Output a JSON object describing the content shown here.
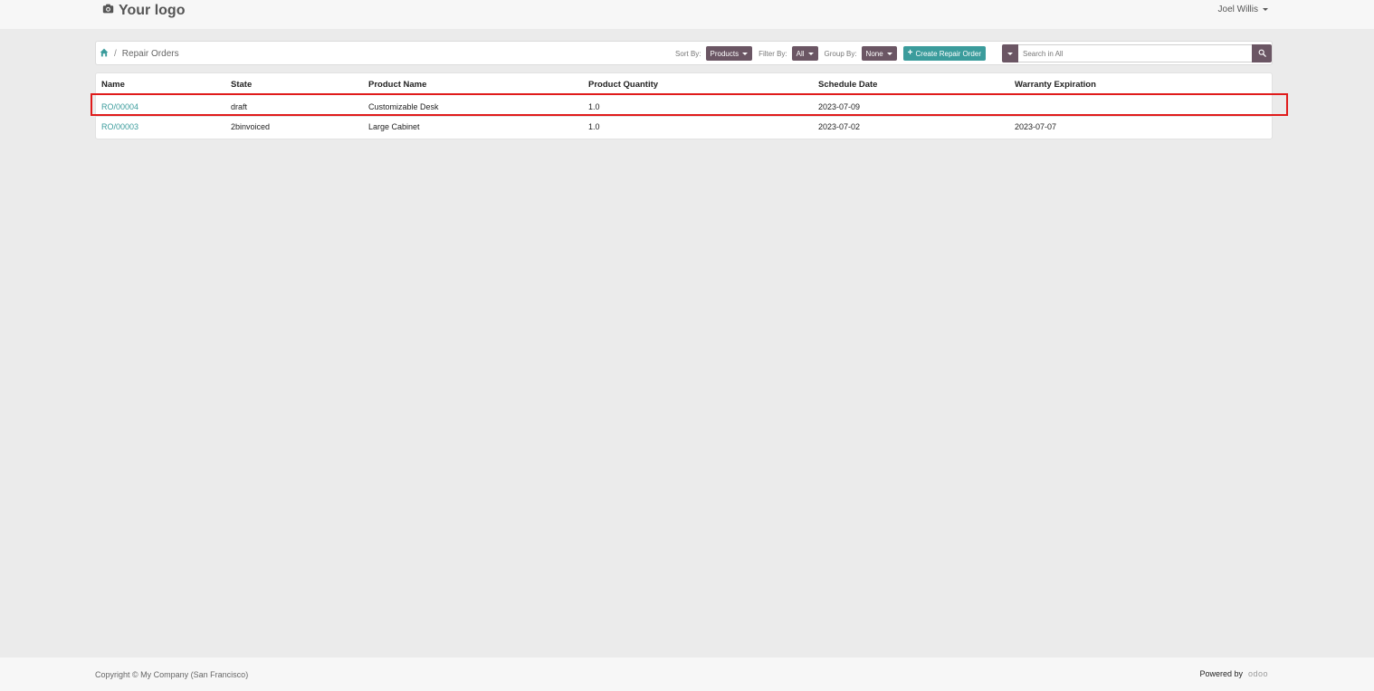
{
  "brand": {
    "logo_text": "Your logo",
    "logo_icon": "camera-icon"
  },
  "user": {
    "name": "Joel Willis"
  },
  "breadcrumb": {
    "home_icon": "home-icon",
    "separator": "/",
    "current": "Repair Orders"
  },
  "controls": {
    "sort_label": "Sort By:",
    "sort_value": "Products",
    "filter_label": "Filter By:",
    "filter_value": "All",
    "group_label": "Group By:",
    "group_value": "None",
    "create_icon": "plus-icon",
    "create_label": "Create Repair Order"
  },
  "search": {
    "placeholder": "Search in All",
    "value": "",
    "button_icon": "search-icon"
  },
  "table": {
    "headers": [
      "Name",
      "State",
      "Product Name",
      "Product Quantity",
      "Schedule Date",
      "Warranty Expiration"
    ],
    "rows": [
      [
        "RO/00004",
        "draft",
        "Customizable Desk",
        "1.0",
        "2023-07-09",
        ""
      ],
      [
        "RO/00003",
        "2binvoiced",
        "Large Cabinet",
        "1.0",
        "2023-07-02",
        "2023-07-07"
      ]
    ]
  },
  "footer": {
    "copyright": "Copyright © My Company (San Francisco)",
    "powered_by": "Powered by",
    "powered_brand": "odoo"
  },
  "colors": {
    "accent": "#3b9c9c",
    "button": "#6b5664",
    "highlight": "#e01b1b",
    "background": "#ebebeb"
  }
}
